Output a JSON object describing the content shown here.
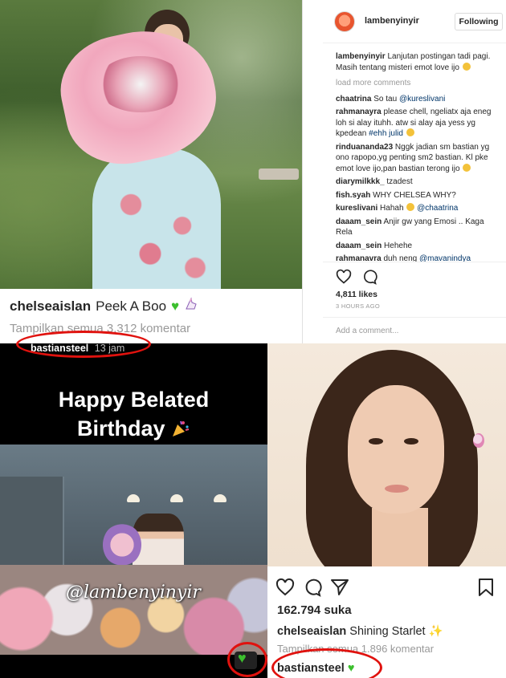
{
  "top_left_post": {
    "username": "chelseaislan",
    "caption": "Peek A Boo",
    "view_comments": "Tampilkan semua 3.312 komentar"
  },
  "right_panel": {
    "handle": "lambenyinyir",
    "follow_label": "Following",
    "caption_user": "lambenyinyir",
    "caption_text": "Lanjutan postingan tadi pagi. Masih tentang misteri emot love ijo",
    "load_more": "load more comments",
    "comments": [
      {
        "user": "chaatrina",
        "text": "So tau",
        "tag": "@kureslivani",
        "after": ""
      },
      {
        "user": "rahmanayra",
        "text": "please chell, ngeliatx aja eneg loh si alay ituhh. atw si alay aja yess yg kpedean",
        "tag": "#ehh julid",
        "after": ""
      },
      {
        "user": "rinduananda23",
        "text": "Nggk jadian sm bastian yg ono rapopo,yg penting sm2 bastian. Kl pke emot love ijo,pan bastian terong ijo",
        "tag": "",
        "after": ""
      },
      {
        "user": "diarymilkkk_",
        "text": "tzadest",
        "tag": "",
        "after": ""
      },
      {
        "user": "fish.syah",
        "text": "WHY CHELSEA WHY?",
        "tag": "",
        "after": ""
      },
      {
        "user": "kureslivani",
        "text": "Hahah",
        "tag": "@chaatrina",
        "after": ""
      },
      {
        "user": "daaam_sein",
        "text": "Anjir gw yang Emosi .. Kaga Rela",
        "tag": "",
        "after": ""
      },
      {
        "user": "daaam_sein",
        "text": "Hehehe",
        "tag": "",
        "after": ""
      },
      {
        "user": "rahmanavra",
        "text": "duh neng",
        "tag": "@mavanindya",
        "after": ""
      }
    ],
    "likes": "4,811 likes",
    "time": "3 HOURS AGO",
    "add_comment": "Add a comment..."
  },
  "story": {
    "username": "bastiansteel",
    "time": "13 jam",
    "greeting_line1": "Happy Belated",
    "greeting_line2": "Birthday",
    "watermark": "@lambenyinyir"
  },
  "bottom_right_post": {
    "likes": "162.794 suka",
    "caption_user": "chelseaislan",
    "caption": "Shining Starlet",
    "view_comments": "Tampilkan semua 1.896 komentar",
    "last_commenter": "bastiansteel"
  },
  "colors": {
    "green_heart": "#3cbf2e",
    "annotation_red": "#e0120e"
  },
  "icons": [
    "heart-icon",
    "comment-icon",
    "share-icon",
    "bookmark-icon",
    "unicorn-icon",
    "star-icon",
    "party-popper-icon"
  ]
}
